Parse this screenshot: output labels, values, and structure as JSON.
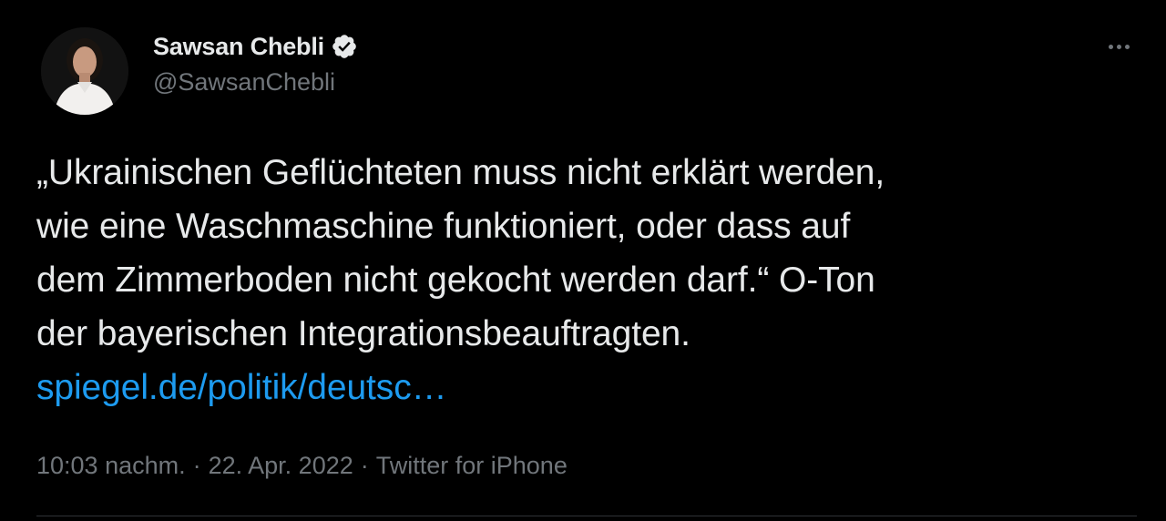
{
  "author": {
    "display_name": "Sawsan Chebli",
    "handle": "@SawsanChebli",
    "verified_icon": "verified-badge-icon"
  },
  "tweet": {
    "lines": [
      "„Ukrainischen Geflüchteten muss nicht erklärt werden,",
      "wie eine Waschmaschine funktioniert, oder dass auf",
      "dem Zimmerboden nicht gekocht werden darf.“ O-Ton",
      "der bayerischen Integrationsbeauftragten."
    ],
    "link_text": "spiegel.de/politik/deutsc…"
  },
  "meta": {
    "time": "10:03 nachm.",
    "separator": "·",
    "date": "22. Apr. 2022",
    "source": "Twitter for iPhone"
  },
  "colors": {
    "background": "#000000",
    "text": "#e7e9ea",
    "secondary": "#71767b",
    "link": "#1d9bf0"
  }
}
